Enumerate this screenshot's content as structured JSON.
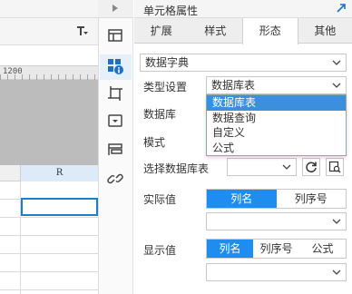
{
  "sheet": {
    "ruler_number": "1200",
    "column_header": "R"
  },
  "panel": {
    "title": "单元格属性",
    "tabs": [
      {
        "label": "扩展"
      },
      {
        "label": "样式"
      },
      {
        "label": "形态"
      },
      {
        "label": "其他"
      }
    ],
    "active_tab": "形态"
  },
  "form": {
    "shape_select": "数据字典",
    "type_label": "类型设置",
    "type_value": "数据库表",
    "type_options": [
      "数据库表",
      "数据查询",
      "自定义",
      "公式"
    ],
    "database_label": "数据库",
    "mode_label": "模式",
    "table_label": "选择数据库表",
    "table_value": "",
    "actual_label": "实际值",
    "actual_seg": [
      "列名",
      "列序号"
    ],
    "actual_value": "",
    "display_label": "显示值",
    "display_seg": [
      "列名",
      "列序号",
      "公式"
    ],
    "display_value": ""
  },
  "icons": {
    "strip": [
      "cell-element-icon",
      "cell-attribute-icon",
      "float-element-icon",
      "widget-icon",
      "condition-icon",
      "hyperlink-icon"
    ]
  },
  "colors": {
    "accent": "#1f8cf0",
    "selection": "#3b8fdd"
  }
}
